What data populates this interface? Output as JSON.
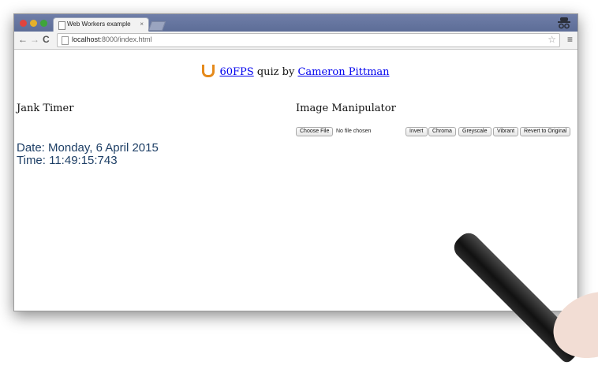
{
  "browser": {
    "tab_title": "Web Workers example",
    "tab_close": "×",
    "url_host": "localhost",
    "url_path": ":8000/index.html",
    "back_icon": "←",
    "forward_icon": "→",
    "reload_icon": "C",
    "star_icon": "☆",
    "menu_icon": "≡"
  },
  "header": {
    "logo_name": "udacity-logo",
    "link_60fps": "60FPS",
    "middle_text": " quiz by ",
    "link_author": "Cameron Pittman"
  },
  "jank": {
    "heading": "Jank Timer",
    "date": "Date: Monday, 6 April 2015",
    "time": "Time: 11:49:15:743"
  },
  "image": {
    "heading": "Image Manipulator",
    "choose_file": "Choose File",
    "no_file": "No file chosen",
    "buttons": {
      "invert": "Invert",
      "chroma": "Chroma",
      "greyscale": "Greyscale",
      "vibrant": "Vibrant",
      "revert": "Revert to Original"
    }
  },
  "colors": {
    "accent_logo": "#e58a1c",
    "link": "#0000ee",
    "readout": "#1e3f66"
  }
}
